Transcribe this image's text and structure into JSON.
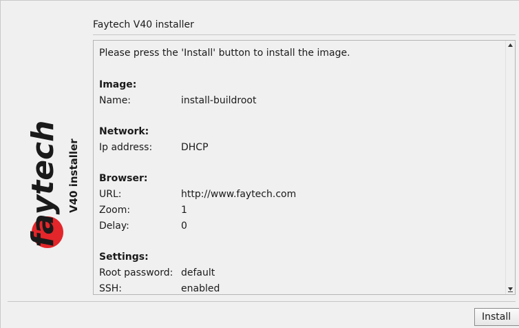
{
  "header": {
    "title": "Faytech V40 installer"
  },
  "brand": {
    "logo_text": "faytech",
    "subtitle": "V40 installer",
    "accent_color": "#e3262a"
  },
  "content": {
    "intro": "Please press the 'Install' button to install the image.",
    "sections": [
      {
        "heading": "Image:",
        "rows": [
          {
            "key": "Name:",
            "value": "install-buildroot"
          }
        ]
      },
      {
        "heading": "Network:",
        "rows": [
          {
            "key": "Ip address:",
            "value": "DHCP"
          }
        ]
      },
      {
        "heading": "Browser:",
        "rows": [
          {
            "key": "URL:",
            "value": "http://www.faytech.com"
          },
          {
            "key": "Zoom:",
            "value": "1"
          },
          {
            "key": "Delay:",
            "value": "0"
          }
        ]
      },
      {
        "heading": "Settings:",
        "rows": [
          {
            "key": "Root password:",
            "value": "default"
          },
          {
            "key": "SSH:",
            "value": "enabled"
          }
        ]
      }
    ]
  },
  "scrollbar": {
    "up_icon": "arrow-up-icon",
    "down_icon": "arrow-down-icon"
  },
  "footer": {
    "install_label": "Install"
  }
}
